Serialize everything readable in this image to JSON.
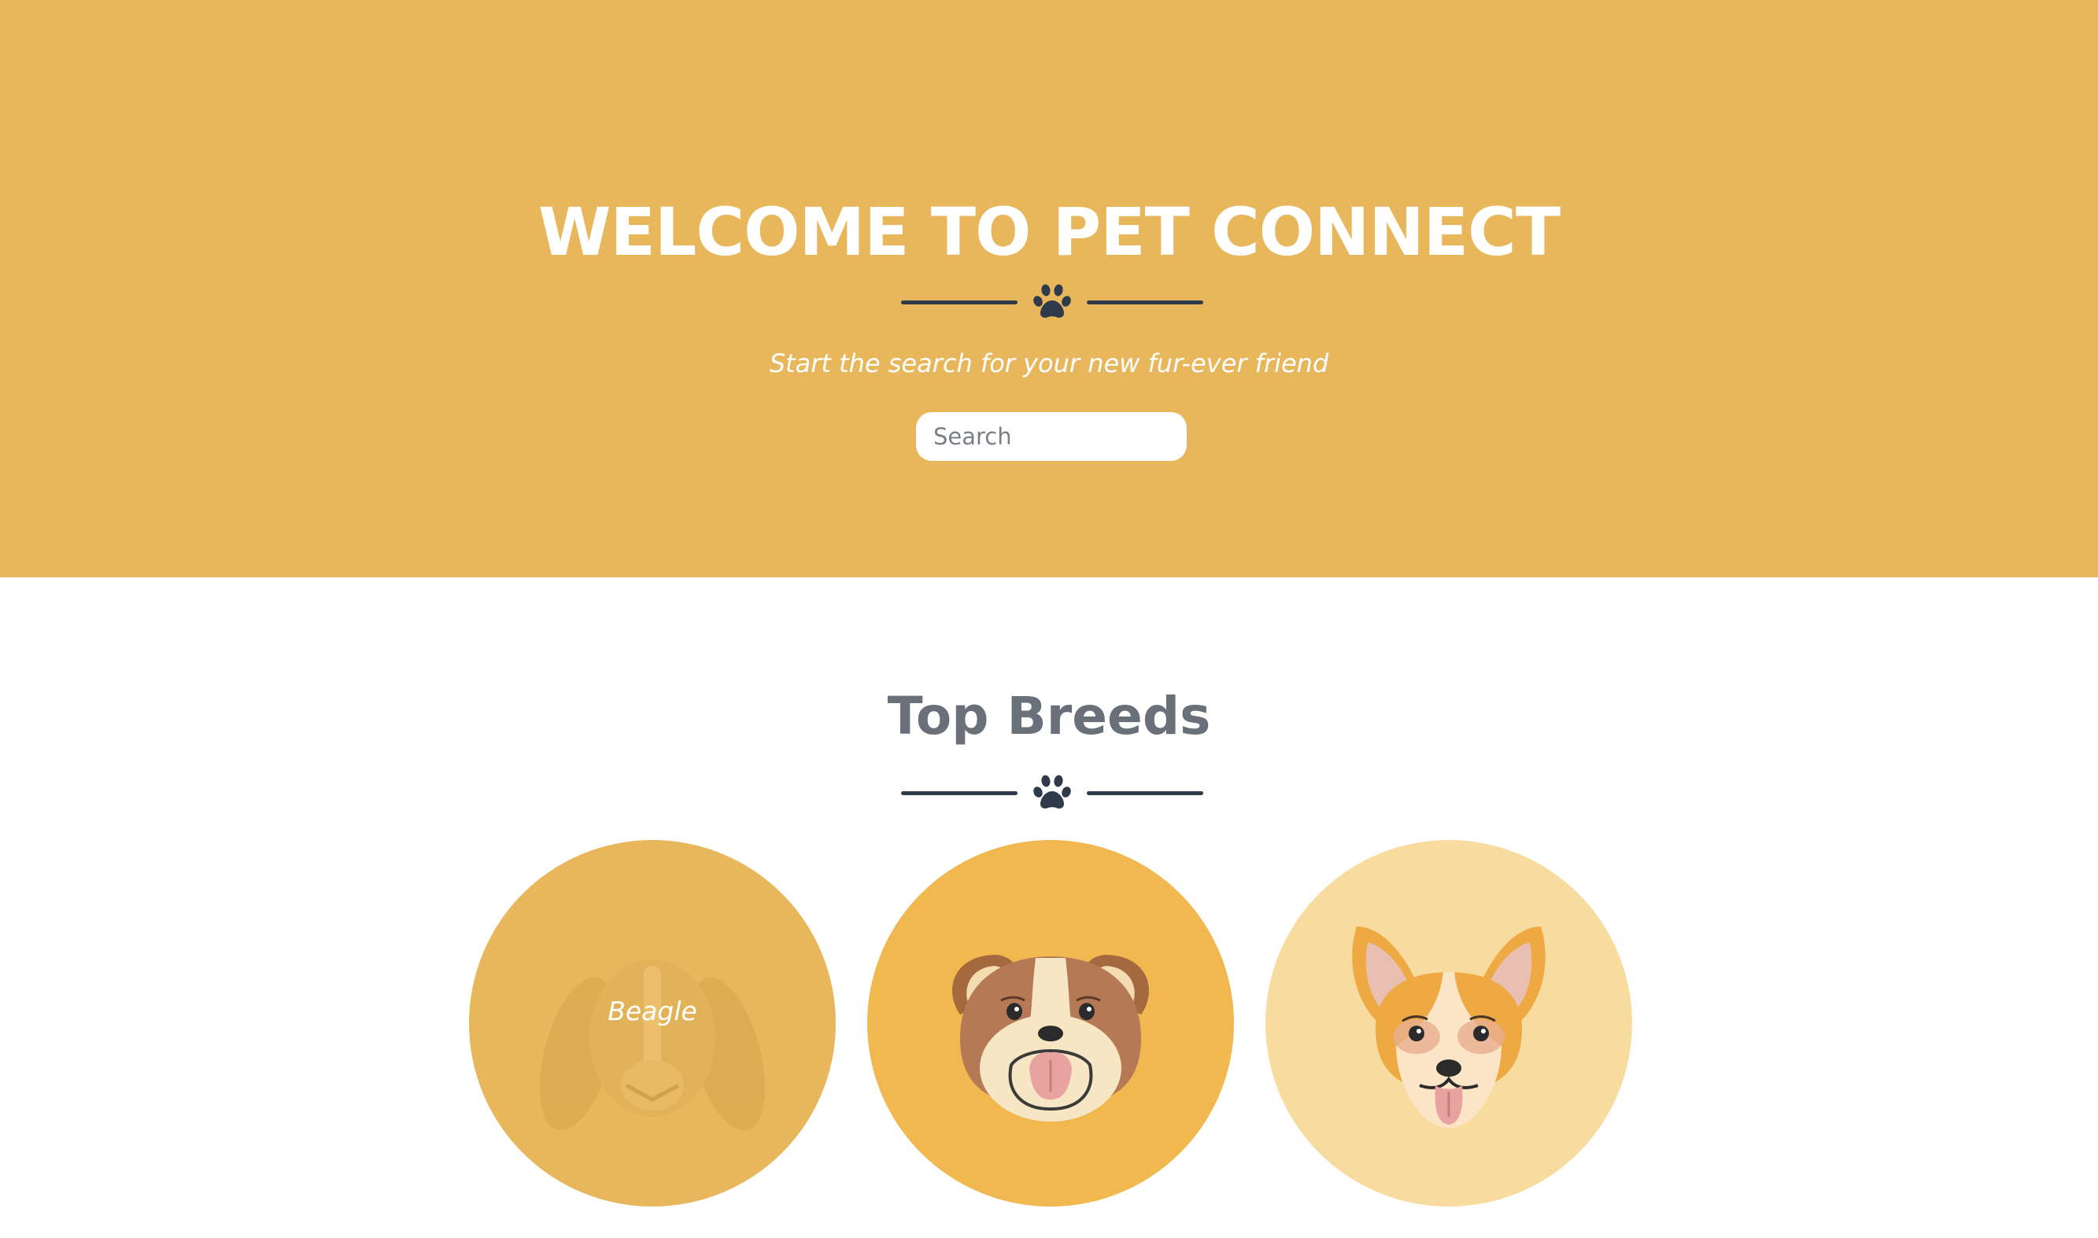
{
  "hero": {
    "title": "WELCOME TO PET CONNECT",
    "subtitle": "Start the search for your new fur-ever friend",
    "search_placeholder": "Search",
    "background_color": "#e8b75c"
  },
  "top_breeds": {
    "title": "Top Breeds",
    "breeds": [
      {
        "label": "Beagle",
        "icon": "beagle-dog-icon",
        "color": "#e8b75c"
      },
      {
        "label": "",
        "icon": "bulldog-dog-icon",
        "color": "#f1b84f"
      },
      {
        "label": "",
        "icon": "corgi-dog-icon",
        "color": "#f8dc9f"
      }
    ]
  },
  "colors": {
    "accent_dark": "#2f3a4a",
    "heading_gray": "#697079"
  }
}
